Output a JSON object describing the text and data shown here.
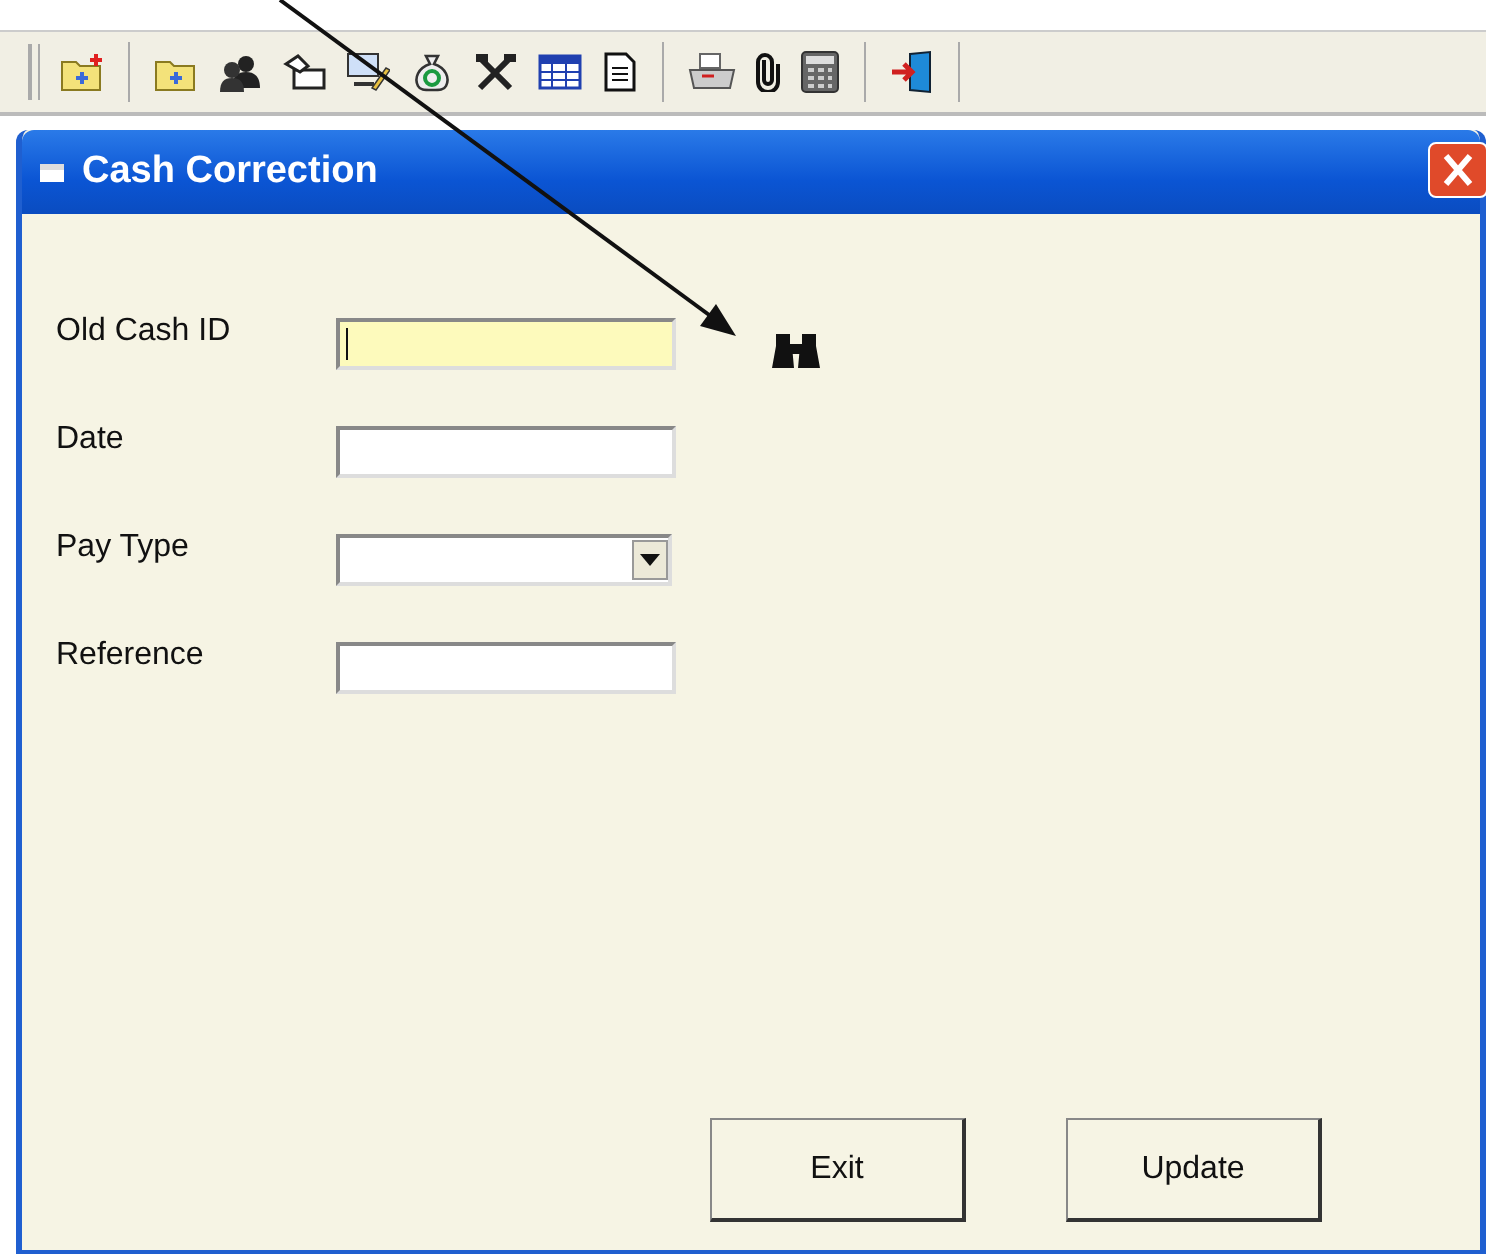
{
  "window": {
    "title": "Cash Correction"
  },
  "fields": [
    {
      "label": "Old Cash ID",
      "kind": "text",
      "focused": true,
      "lookup": true
    },
    {
      "label": "Date",
      "kind": "text",
      "focused": false,
      "lookup": false
    },
    {
      "label": "Pay Type",
      "kind": "dropdown",
      "focused": false,
      "lookup": false
    },
    {
      "label": "Reference",
      "kind": "text",
      "focused": false,
      "lookup": false
    }
  ],
  "buttons": [
    {
      "label": "Exit"
    },
    {
      "label": "Update"
    }
  ]
}
